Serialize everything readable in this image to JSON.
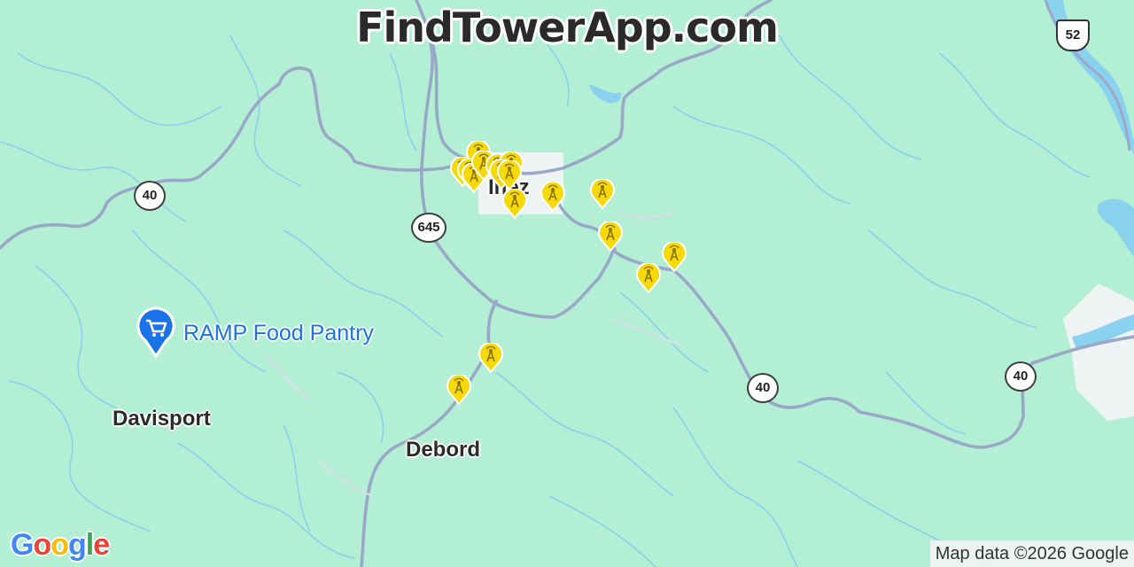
{
  "header": {
    "title": "FindTowerApp.com"
  },
  "places": [
    {
      "name": "Inez"
    },
    {
      "name": "Davisport"
    },
    {
      "name": "Debord"
    }
  ],
  "poi": {
    "label": "RAMP Food Pantry",
    "icon": "shopping-cart-icon",
    "color": "#1a73e8"
  },
  "routes": {
    "r40": "40",
    "r645": "645",
    "r52": "52"
  },
  "tower_marker": {
    "icon": "tower-icon",
    "color": "#f5d90a",
    "count": 18
  },
  "footer": {
    "logo": "Google",
    "attribution": "Map data ©2026 Google"
  },
  "colors": {
    "land": "#b3efd4",
    "water": "#8ad0ef",
    "road": "#9aa8c8",
    "urban": "#eef3f3"
  }
}
